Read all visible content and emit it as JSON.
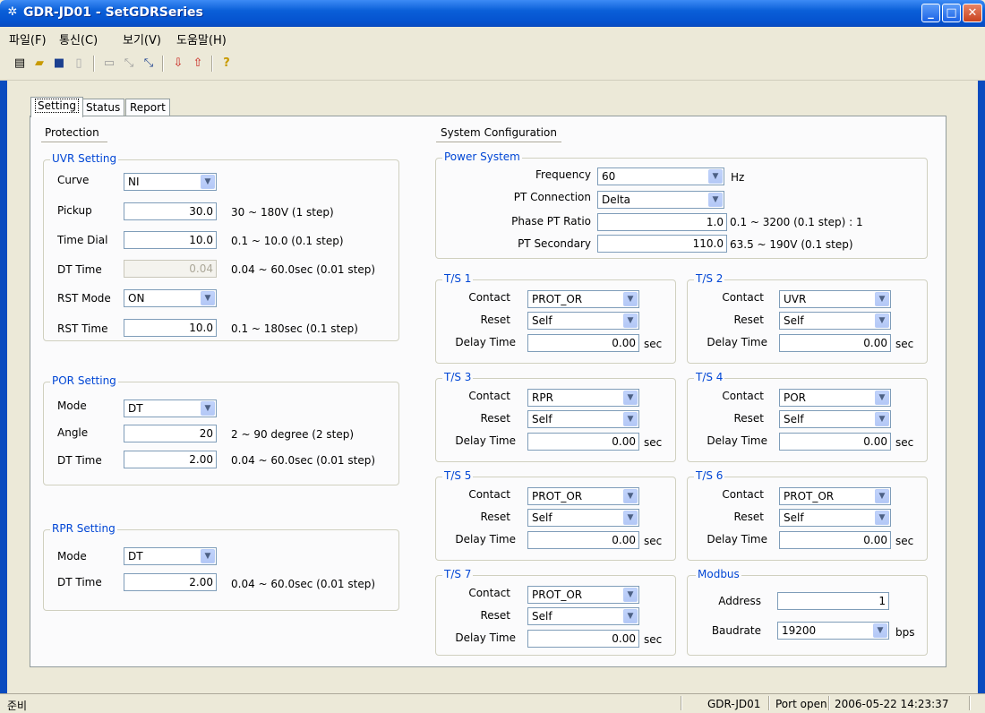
{
  "window": {
    "title": "GDR-JD01 - SetGDRSeries"
  },
  "menu": [
    "파일(F)",
    "통신(C)",
    "보기(V)",
    "도움말(H)"
  ],
  "tabs": [
    "Setting",
    "Status",
    "Report"
  ],
  "protection": {
    "title": "Protection",
    "uvr": {
      "title": "UVR Setting",
      "curve_label": "Curve",
      "curve_value": "NI",
      "pickup_label": "Pickup",
      "pickup_value": "30.0",
      "pickup_hint": "30 ~ 180V (1 step)",
      "timedial_label": "Time Dial",
      "timedial_value": "10.0",
      "timedial_hint": "0.1 ~ 10.0 (0.1 step)",
      "dttime_label": "DT Time",
      "dttime_value": "0.04",
      "dttime_hint": "0.04 ~ 60.0sec (0.01 step)",
      "rstmode_label": "RST Mode",
      "rstmode_value": "ON",
      "rsttime_label": "RST Time",
      "rsttime_value": "10.0",
      "rsttime_hint": "0.1 ~ 180sec (0.1 step)"
    },
    "por": {
      "title": "POR Setting",
      "mode_label": "Mode",
      "mode_value": "DT",
      "angle_label": "Angle",
      "angle_value": "20",
      "angle_hint": "2 ~ 90 degree (2 step)",
      "dttime_label": "DT Time",
      "dttime_value": "2.00",
      "dttime_hint": "0.04 ~ 60.0sec (0.01 step)"
    },
    "rpr": {
      "title": "RPR Setting",
      "mode_label": "Mode",
      "mode_value": "DT",
      "dttime_label": "DT Time",
      "dttime_value": "2.00",
      "dttime_hint": "0.04 ~ 60.0sec (0.01 step)"
    }
  },
  "system": {
    "title": "System Configuration",
    "power": {
      "title": "Power System",
      "freq_label": "Frequency",
      "freq_value": "60",
      "freq_unit": "Hz",
      "ptconn_label": "PT Connection",
      "ptconn_value": "Delta",
      "ptratio_label": "Phase PT Ratio",
      "ptratio_value": "1.0",
      "ptratio_hint": "0.1 ~ 3200 (0.1 step) : 1",
      "ptsec_label": "PT Secondary",
      "ptsec_value": "110.0",
      "ptsec_hint": "63.5 ~ 190V (0.1 step)"
    },
    "ts": [
      {
        "title": "T/S 1",
        "contact": "PROT_OR",
        "reset": "Self",
        "delay": "0.00"
      },
      {
        "title": "T/S 2",
        "contact": "UVR",
        "reset": "Self",
        "delay": "0.00"
      },
      {
        "title": "T/S 3",
        "contact": "RPR",
        "reset": "Self",
        "delay": "0.00"
      },
      {
        "title": "T/S 4",
        "contact": "POR",
        "reset": "Self",
        "delay": "0.00"
      },
      {
        "title": "T/S 5",
        "contact": "PROT_OR",
        "reset": "Self",
        "delay": "0.00"
      },
      {
        "title": "T/S 6",
        "contact": "PROT_OR",
        "reset": "Self",
        "delay": "0.00"
      },
      {
        "title": "T/S 7",
        "contact": "PROT_OR",
        "reset": "Self",
        "delay": "0.00"
      }
    ],
    "ts_labels": {
      "contact": "Contact",
      "reset": "Reset",
      "delay": "Delay Time",
      "unit": "sec"
    },
    "modbus": {
      "title": "Modbus",
      "address_label": "Address",
      "address_value": "1",
      "baud_label": "Baudrate",
      "baud_value": "19200",
      "baud_unit": "bps"
    }
  },
  "statusbar": {
    "ready": "준비",
    "device": "GDR-JD01",
    "port": "Port open",
    "datetime": "2006-05-22 14:23:37"
  }
}
